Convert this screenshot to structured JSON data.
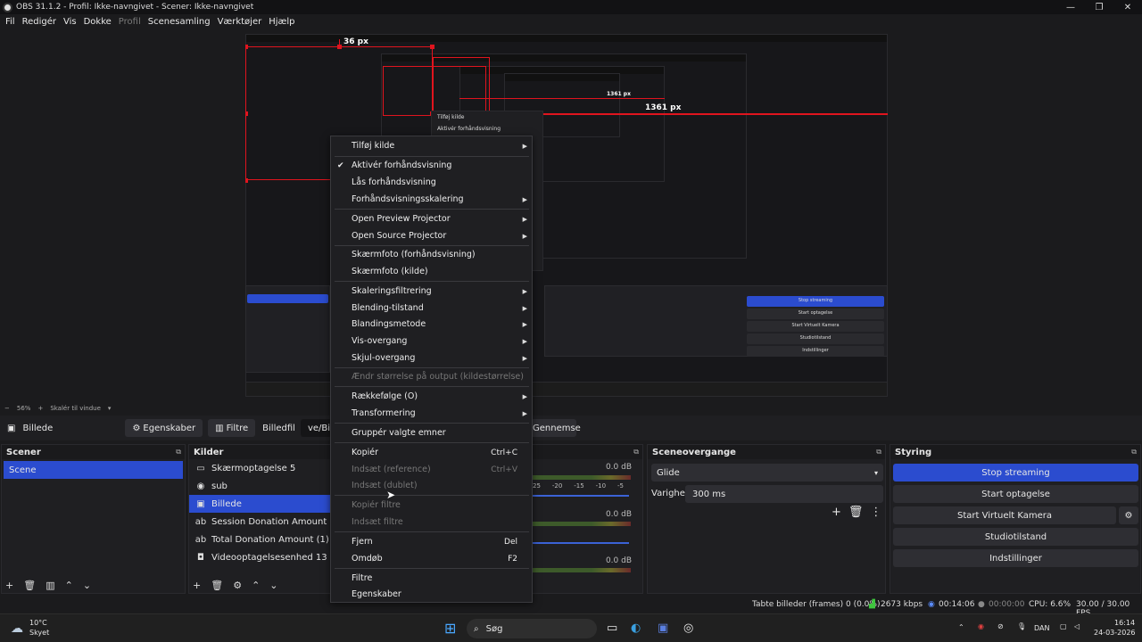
{
  "window": {
    "title": "OBS 31.1.2 - Profil: Ikke-navngivet - Scener: Ikke-navngivet",
    "min": "—",
    "max": "❐",
    "close": "✕"
  },
  "menubar": {
    "items": [
      "Fil",
      "Redigér",
      "Vis",
      "Dokke",
      "Profil",
      "Scenesamling",
      "Værktøjer",
      "Hjælp"
    ]
  },
  "preview": {
    "label_top": "36 px",
    "label_right": "1361 px",
    "label_small": "1361 px",
    "nested_context": [
      "Tilføj kilde",
      "Aktivér forhåndsvisning"
    ]
  },
  "zoombar": {
    "minus": "−",
    "zoom": "56%",
    "plus": "+",
    "mode": "Skalér til vindue",
    "dropdown": "▾"
  },
  "sourcebar": {
    "source_name": "Billede",
    "props": "Egenskaber",
    "filters": "Filtre",
    "file_label": "Billedfil",
    "file_path": "ve/Billeder/S",
    "browse": "Gennemse"
  },
  "scenes": {
    "title": "Scener",
    "items": [
      "Scene"
    ]
  },
  "sources": {
    "title": "Kilder",
    "items": [
      {
        "icon": "monitor-icon",
        "label": "Skærmoptagelse 5"
      },
      {
        "icon": "globe-icon",
        "label": "sub"
      },
      {
        "icon": "image-icon",
        "label": "Billede"
      },
      {
        "icon": "text-icon",
        "label": "Session Donation Amount"
      },
      {
        "icon": "text-icon",
        "label": "Total Donation Amount (1)"
      },
      {
        "icon": "camera-icon",
        "label": "Videooptagelsesenhed 13"
      }
    ]
  },
  "mixer": {
    "db": [
      "0.0 dB",
      "0.0 dB",
      "0.0 dB"
    ],
    "ticks": [
      "25",
      "-20",
      "-15",
      "-10",
      "-5"
    ]
  },
  "transitions": {
    "title": "Sceneovergange",
    "selected": "Glide",
    "duration_label": "Varighed",
    "duration": "300 ms"
  },
  "controls": {
    "title": "Styring",
    "buttons": [
      "Stop streaming",
      "Start optagelse",
      "Start Virtuelt Kamera",
      "Studiotilstand",
      "Indstillinger"
    ]
  },
  "context_menu": {
    "items": [
      {
        "label": "Tilføj kilde",
        "sub": true
      },
      {
        "label": "Aktivér forhåndsvisning",
        "check": true
      },
      {
        "label": "Lås forhåndsvisning"
      },
      {
        "label": "Forhåndsvisningsskalering",
        "sub": true
      },
      {
        "label": "Open Preview Projector",
        "sub": true
      },
      {
        "label": "Open Source Projector",
        "sub": true
      },
      {
        "label": "Skærmfoto (forhåndsvisning)"
      },
      {
        "label": "Skærmfoto (kilde)"
      },
      {
        "label": "Skaleringsfiltrering",
        "sub": true
      },
      {
        "label": "Blending-tilstand",
        "sub": true
      },
      {
        "label": "Blandingsmetode",
        "sub": true
      },
      {
        "label": "Vis-overgang",
        "sub": true
      },
      {
        "label": "Skjul-overgang",
        "sub": true
      },
      {
        "label": "Ændr størrelse på output (kildestørrelse)",
        "disabled": true
      },
      {
        "label": "Rækkefølge (O)",
        "sub": true
      },
      {
        "label": "Transformering",
        "sub": true
      },
      {
        "label": "Gruppér valgte emner"
      },
      {
        "label": "Kopiér",
        "shortcut": "Ctrl+C"
      },
      {
        "label": "Indsæt (reference)",
        "shortcut": "Ctrl+V",
        "disabled": true
      },
      {
        "label": "Indsæt (dublet)",
        "disabled": true
      },
      {
        "label": "Kopiér filtre",
        "disabled": true
      },
      {
        "label": "Indsæt filtre",
        "disabled": true
      },
      {
        "label": "Fjern",
        "shortcut": "Del"
      },
      {
        "label": "Omdøb",
        "shortcut": "F2"
      },
      {
        "label": "Filtre"
      },
      {
        "label": "Egenskaber"
      }
    ]
  },
  "statusbar": {
    "dropped": "Tabte billeder (frames) 0 (0.0%)",
    "kbps": "2673 kbps",
    "stream_time": "00:14:06",
    "rec_time": "00:00:00",
    "cpu": "CPU: 6.6%",
    "fps": "30.00 / 30.00 FPS"
  },
  "taskbar": {
    "temp": "10°C",
    "weather": "Skyet",
    "search": "Søg",
    "lang": "DAN",
    "time": "16:14",
    "date": "24-03-2026"
  },
  "colors": {
    "accent": "#2b4ccf",
    "red": "#e0141e",
    "bg": "#1b1b1d"
  }
}
